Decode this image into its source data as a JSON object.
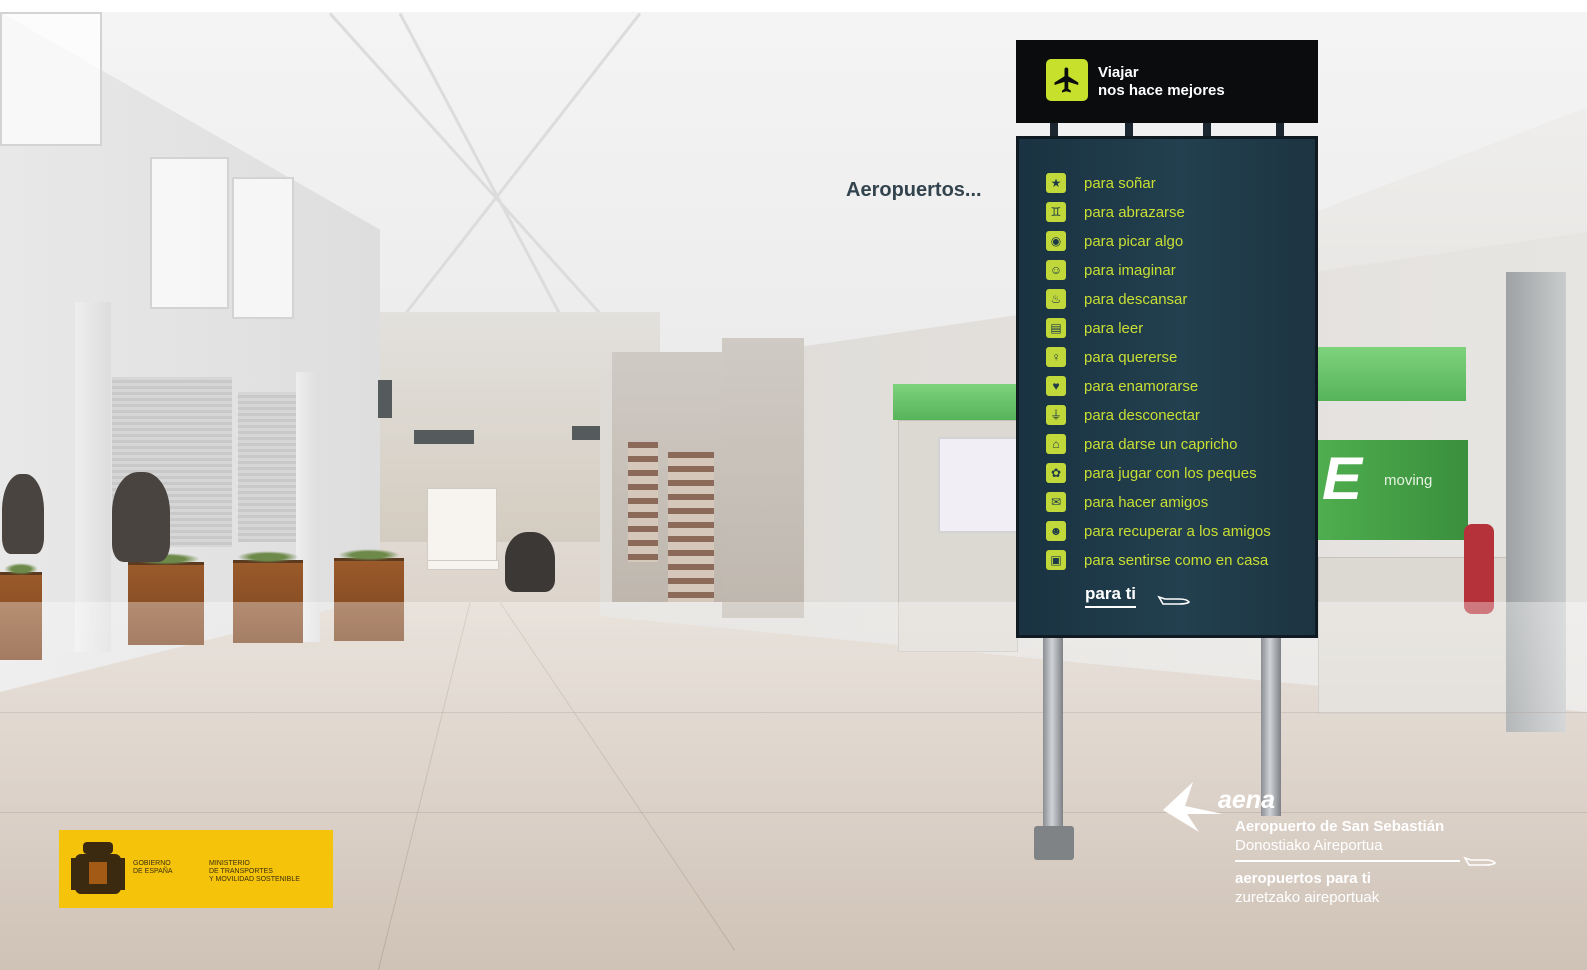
{
  "sign": {
    "header_line1": "Viajar",
    "header_line2": "nos hace mejores",
    "heading": "Aeropuertos...",
    "items": [
      {
        "label": "para soñar",
        "icon": "star-icon"
      },
      {
        "label": "para abrazarse",
        "icon": "hug-icon"
      },
      {
        "label": "para picar algo",
        "icon": "food-icon"
      },
      {
        "label": "para imaginar",
        "icon": "smile-icon"
      },
      {
        "label": "para descansar",
        "icon": "rest-icon"
      },
      {
        "label": "para leer",
        "icon": "book-icon"
      },
      {
        "label": "para quererse",
        "icon": "mirror-icon"
      },
      {
        "label": "para enamorarse",
        "icon": "heart-icon"
      },
      {
        "label": "para desconectar",
        "icon": "plug-icon"
      },
      {
        "label": "para darse un capricho",
        "icon": "shopping-bag-icon"
      },
      {
        "label": "para jugar con los peques",
        "icon": "toy-icon"
      },
      {
        "label": "para hacer amigos",
        "icon": "chat-icon"
      },
      {
        "label": "para recuperar a los amigos",
        "icon": "people-icon"
      },
      {
        "label": "para sentirse como en casa",
        "icon": "suitcase-icon"
      }
    ],
    "footer": "para ti",
    "accent_color": "#c9df34",
    "panel_color": "#1f3a49"
  },
  "aena": {
    "brand": "aena",
    "airport_name": "Aeropuerto de San Sebastián",
    "airport_name_basque": "Donostiako Aireportua",
    "slogan": "aeropuertos para ti",
    "slogan_basque": "zuretzako aireportuak"
  },
  "government": {
    "gobierno": "GOBIERNO\nDE ESPAÑA",
    "ministerio": "MINISTERIO\nDE TRANSPORTES\nY MOVILIDAD SOSTENIBLE",
    "color": "#f5c40a"
  },
  "background": {
    "shop_sign_text": "moving",
    "shop_sign_letter": "E"
  }
}
